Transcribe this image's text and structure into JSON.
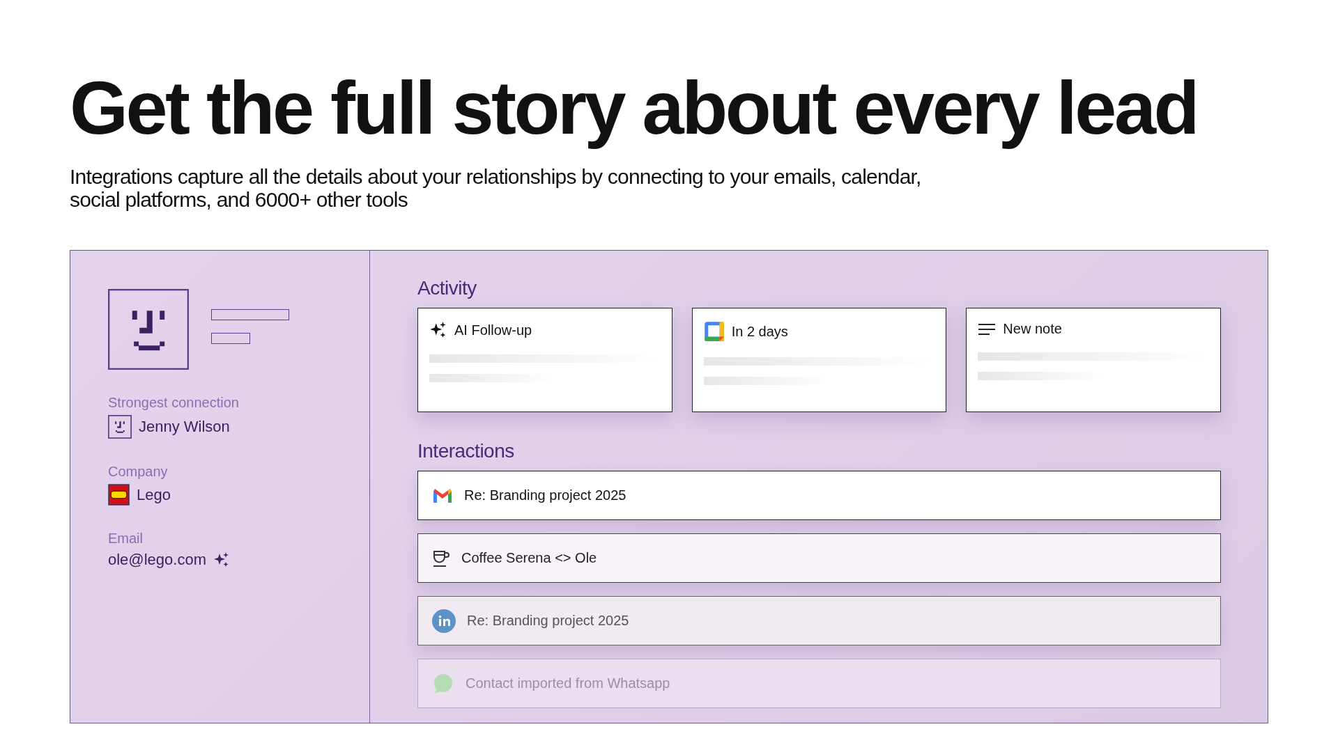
{
  "headline": "Get the full story about every lead",
  "subtitle": "Integrations capture all the details about your relationships by connecting to your emails, calendar, social platforms, and 6000+ other tools",
  "profile": {
    "fields": [
      {
        "label": "Strongest connection",
        "value": "Jenny Wilson",
        "kind": "person"
      },
      {
        "label": "Company",
        "value": "Lego",
        "kind": "company"
      },
      {
        "label": "Email",
        "value": "ole@lego.com",
        "kind": "email"
      }
    ]
  },
  "activity": {
    "title": "Activity",
    "cards": [
      {
        "kind": "ai",
        "label": "AI Follow-up"
      },
      {
        "kind": "calendar",
        "label": "In 2 days"
      },
      {
        "kind": "note",
        "label": "New note"
      }
    ]
  },
  "interactions": {
    "title": "Interactions",
    "items": [
      {
        "kind": "gmail",
        "label": "Re: Branding project 2025"
      },
      {
        "kind": "coffee",
        "label": "Coffee Serena <> Ole"
      },
      {
        "kind": "linkedin",
        "label": "Re: Branding project 2025"
      },
      {
        "kind": "whatsapp",
        "label": "Contact imported from Whatsapp"
      }
    ]
  }
}
